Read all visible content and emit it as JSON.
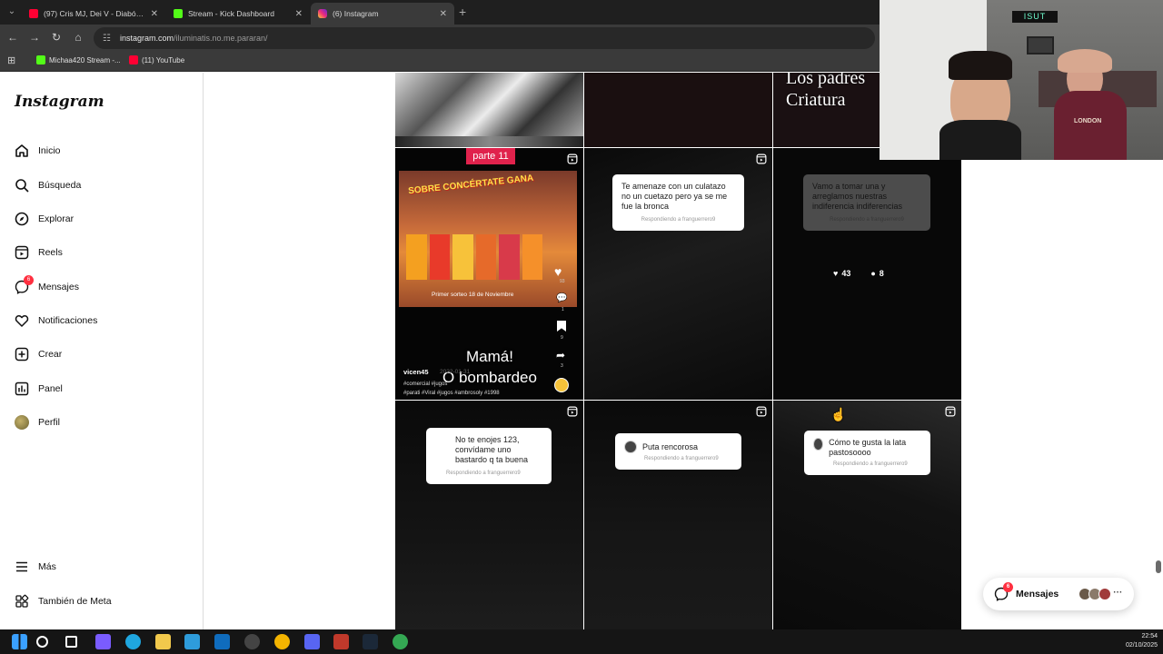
{
  "browser": {
    "tabs": [
      {
        "label": "(97) Cris MJ, Dei V - Diabólica (",
        "icon": "youtube-icon",
        "color": "#ff0033"
      },
      {
        "label": "Stream - Kick Dashboard",
        "icon": "kick-icon",
        "color": "#53fc18"
      },
      {
        "label": "(6) Instagram",
        "icon": "instagram-icon",
        "color": "#e1306c"
      }
    ],
    "url_host": "instagram.com",
    "url_path": "/iluminatis.no.me.pararan/",
    "bookmarks": [
      {
        "label": "Michaa420 Stream -...",
        "icon": "kick-icon",
        "color": "#53fc18"
      },
      {
        "label": "(11) YouTube",
        "icon": "youtube-icon",
        "color": "#ff0033"
      }
    ]
  },
  "sidebar": {
    "logo": "Instagram",
    "items": [
      {
        "label": "Inicio",
        "icon": "home-icon"
      },
      {
        "label": "Búsqueda",
        "icon": "search-icon"
      },
      {
        "label": "Explorar",
        "icon": "compass-icon"
      },
      {
        "label": "Reels",
        "icon": "reels-icon"
      },
      {
        "label": "Mensajes",
        "icon": "messenger-icon",
        "badge": "6"
      },
      {
        "label": "Notificaciones",
        "icon": "heart-icon"
      },
      {
        "label": "Crear",
        "icon": "plus-square-icon"
      },
      {
        "label": "Panel",
        "icon": "chart-icon"
      },
      {
        "label": "Perfil",
        "icon": "avatar"
      }
    ],
    "bottom": [
      {
        "label": "Más",
        "icon": "menu-icon"
      },
      {
        "label": "También de Meta",
        "icon": "meta-icon"
      }
    ]
  },
  "grid": {
    "top_row_partial_text": "Los padres\nCriatura",
    "reel1": {
      "part_label": "parte 11",
      "promo_text": "SOBRE CONCÉRTATE GANA",
      "promo_sub": "Primer sorteo 18 de Noviembre",
      "likes": "93",
      "comments": "1",
      "saves": "9",
      "shares": "3",
      "caption_big": "Mamá!\nO bombardeo",
      "user": "vicen45",
      "date": "2022-01-31",
      "tags": "#comercial #jugos\n#parati #Viral #jugos #ambrosoly #1998"
    },
    "reel2": {
      "text": "Te amenaze con un culatazo no un cuetazo pero ya se me fue la bronca",
      "reply": "Respondiendo a franguerrero9"
    },
    "reel3": {
      "text": "Vamo a tomar una y arreglamos nuestras indiferencia indiferencias",
      "reply": "Respondiendo a franguerrero9",
      "likes": "43",
      "comments": "8"
    },
    "reel4": {
      "text": "No te enojes 123, convídame uno bastardo q ta buena",
      "reply": "Respondiendo a franguerrero9"
    },
    "reel5": {
      "text": "Puta rencorosa",
      "reply": "Respondiendo a franguerrero9"
    },
    "reel6": {
      "text": "Cómo te gusta la lata pastosoooo",
      "reply": "Respondiendo a franguerrero9"
    }
  },
  "webcam": {
    "sign_text": "ISUT",
    "shirt_text": "LONDON"
  },
  "messages_pill": {
    "label": "Mensajes",
    "badge": "6"
  },
  "taskbar": {
    "time": "22:54",
    "date": "02/10/2025",
    "apps": [
      {
        "name": "windows-icon",
        "color": "#3aa0ff"
      },
      {
        "name": "search-icon",
        "color": "#ffffff"
      },
      {
        "name": "task-view-icon",
        "color": "#ffffff"
      },
      {
        "name": "copilot-icon",
        "color": "#7a5cff"
      },
      {
        "name": "edge-icon",
        "color": "#1fa7e0"
      },
      {
        "name": "explorer-icon",
        "color": "#f2c94c"
      },
      {
        "name": "store-icon",
        "color": "#2e9cdb"
      },
      {
        "name": "outlook-icon",
        "color": "#0f6cbd"
      },
      {
        "name": "obs-icon",
        "color": "#444444"
      },
      {
        "name": "chrome-icon",
        "color": "#f4b400"
      },
      {
        "name": "discord-icon",
        "color": "#5865f2"
      },
      {
        "name": "vmix-icon",
        "color": "#c0392b"
      },
      {
        "name": "steam-icon",
        "color": "#1b2838"
      },
      {
        "name": "chrome-profile-icon",
        "color": "#34a853"
      }
    ]
  }
}
